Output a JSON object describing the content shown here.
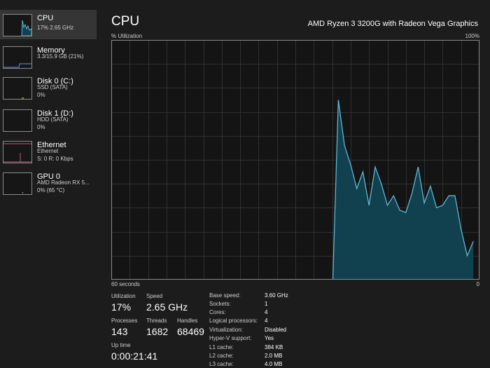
{
  "sidebar": {
    "items": [
      {
        "title": "CPU",
        "sub1": "17% 2.65 GHz",
        "sub2": ""
      },
      {
        "title": "Memory",
        "sub1": "3.3/15.9 GB (21%)",
        "sub2": ""
      },
      {
        "title": "Disk 0 (C:)",
        "sub1": "SSD (SATA)",
        "sub2": "0%"
      },
      {
        "title": "Disk 1 (D:)",
        "sub1": "HDD (SATA)",
        "sub2": "0%"
      },
      {
        "title": "Ethernet",
        "sub1": "Ethernet",
        "sub2": "S: 0 R: 0 Kbps"
      },
      {
        "title": "GPU 0",
        "sub1": "AMD Radeon RX 5...",
        "sub2": "0% (65 °C)"
      }
    ]
  },
  "header": {
    "title": "CPU",
    "model": "AMD Ryzen 3 3200G with Radeon Vega Graphics"
  },
  "graph": {
    "y_label": "% Utilization",
    "y_max_label": "100%",
    "x_left_label": "60 seconds",
    "x_right_label": "0",
    "line_color": "#5fb8d4",
    "fill_color": "#11404f",
    "grid_color": "#2f2f2f",
    "border_color": "#8a8a8a",
    "chart_data": {
      "type": "area",
      "title": "",
      "xlabel": "",
      "ylabel": "% Utilization",
      "xlim": [
        60,
        0
      ],
      "ylim": [
        0,
        100
      ],
      "grid": true,
      "series": [
        {
          "values": [
            [
              24,
              0
            ],
            [
              23.9,
              0
            ],
            [
              23,
              75
            ],
            [
              22,
              56
            ],
            [
              21,
              48
            ],
            [
              20,
              38
            ],
            [
              19,
              45
            ],
            [
              18,
              31
            ],
            [
              17,
              47
            ],
            [
              16,
              40
            ],
            [
              15,
              31
            ],
            [
              14,
              35
            ],
            [
              13,
              29
            ],
            [
              12,
              28
            ],
            [
              11,
              36
            ],
            [
              10,
              47
            ],
            [
              9,
              32
            ],
            [
              8,
              39
            ],
            [
              7,
              30
            ],
            [
              6,
              31
            ],
            [
              5,
              35
            ],
            [
              4,
              35
            ],
            [
              3,
              21
            ],
            [
              2,
              10
            ],
            [
              1,
              16
            ]
          ]
        }
      ]
    }
  },
  "stats": {
    "utilization_label": "Utilization",
    "utilization_value": "17%",
    "speed_label": "Speed",
    "speed_value": "2.65 GHz",
    "processes_label": "Processes",
    "processes_value": "143",
    "threads_label": "Threads",
    "threads_value": "1682",
    "handles_label": "Handles",
    "handles_value": "68469",
    "uptime_label": "Up time",
    "uptime_value": "0:00:21:41"
  },
  "specs": [
    {
      "key": "Base speed:",
      "value": "3.60 GHz"
    },
    {
      "key": "Sockets:",
      "value": "1"
    },
    {
      "key": "Cores:",
      "value": "4"
    },
    {
      "key": "Logical processors:",
      "value": "4"
    },
    {
      "key": "Virtualization:",
      "value": "Disabled"
    },
    {
      "key": "Hyper-V support:",
      "value": "Yes"
    },
    {
      "key": "L1 cache:",
      "value": "384 KB"
    },
    {
      "key": "L2 cache:",
      "value": "2.0 MB"
    },
    {
      "key": "L3 cache:",
      "value": "4.0 MB"
    }
  ]
}
